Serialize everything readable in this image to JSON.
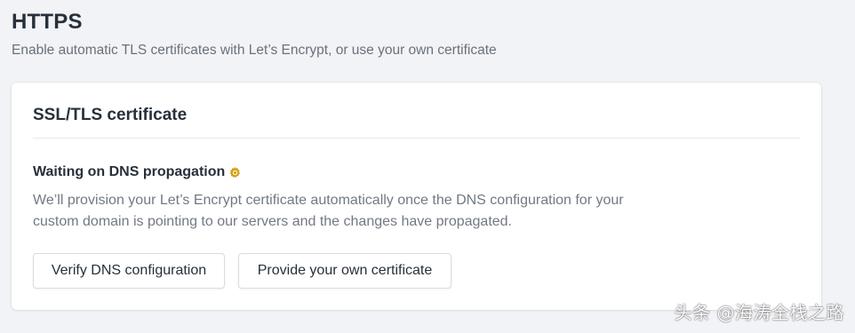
{
  "section": {
    "title": "HTTPS",
    "subtitle": "Enable automatic TLS certificates with Let’s Encrypt, or use your own certificate"
  },
  "card": {
    "title": "SSL/TLS certificate",
    "status_title": "Waiting on DNS propagation",
    "status_icon": "gear-icon",
    "status_icon_color": "#d4a017",
    "status_description": "We’ll provision your Let’s Encrypt certificate automatically once the DNS configuration for your custom domain is pointing to our servers and the changes have propagated.",
    "buttons": {
      "verify_label": "Verify DNS configuration",
      "own_cert_label": "Provide your own certificate"
    }
  },
  "watermark": {
    "text": "头条 @海涛全栈之路"
  }
}
